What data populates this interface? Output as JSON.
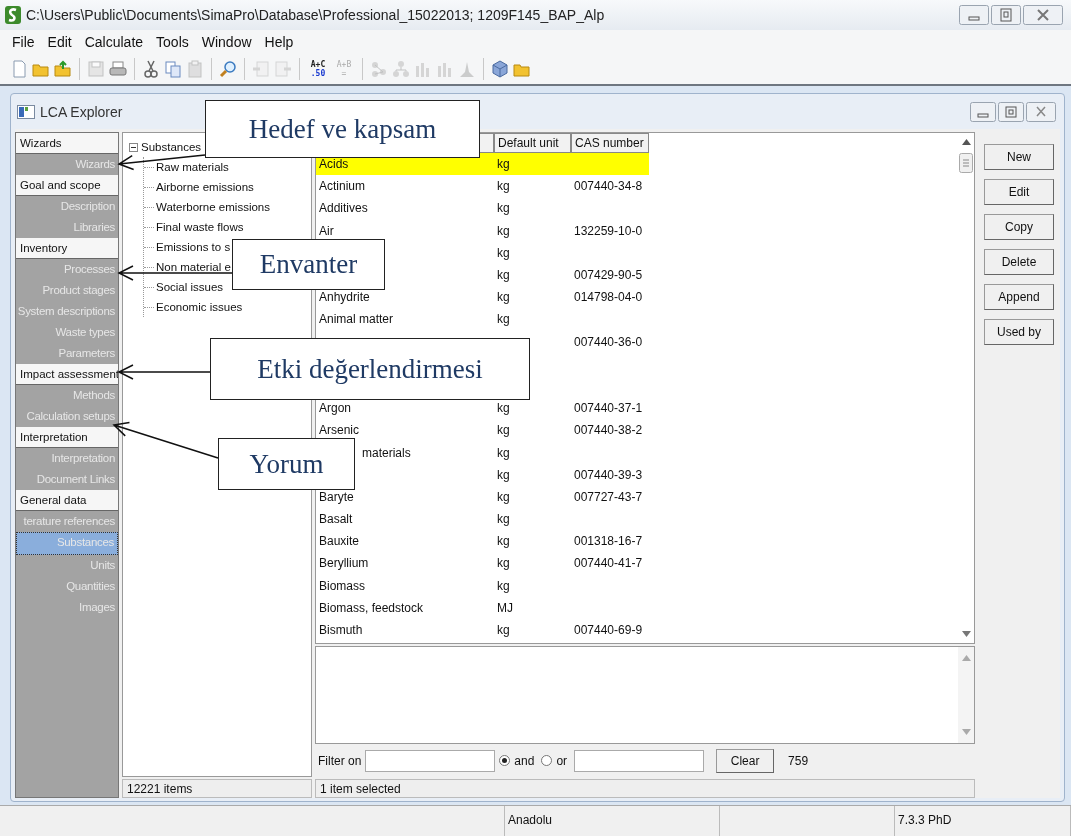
{
  "window": {
    "title": "C:\\Users\\Public\\Documents\\SimaPro\\Database\\Professional_15022013; 1209F145_BAP_Alp"
  },
  "menu": [
    "File",
    "Edit",
    "Calculate",
    "Tools",
    "Window",
    "Help"
  ],
  "toolbar": [
    {
      "kind": "new",
      "disabled": false
    },
    {
      "kind": "open",
      "disabled": false
    },
    {
      "kind": "open-up",
      "disabled": false
    },
    {
      "kind": "sep"
    },
    {
      "kind": "save",
      "disabled": true
    },
    {
      "kind": "print",
      "disabled": false
    },
    {
      "kind": "sep"
    },
    {
      "kind": "cut",
      "disabled": false
    },
    {
      "kind": "copy",
      "disabled": false
    },
    {
      "kind": "paste",
      "disabled": true
    },
    {
      "kind": "sep"
    },
    {
      "kind": "search",
      "disabled": false
    },
    {
      "kind": "sep"
    },
    {
      "kind": "doc-left",
      "disabled": true
    },
    {
      "kind": "doc-right",
      "disabled": true
    },
    {
      "kind": "sep"
    },
    {
      "kind": "formula",
      "top": "A+C",
      "bottom": ".50",
      "disabled": false
    },
    {
      "kind": "formula",
      "top": "A+B",
      "bottom": "=",
      "disabled": true
    },
    {
      "kind": "sep"
    },
    {
      "kind": "network",
      "disabled": true
    },
    {
      "kind": "tree",
      "disabled": true
    },
    {
      "kind": "bars",
      "disabled": true
    },
    {
      "kind": "bars",
      "disabled": true
    },
    {
      "kind": "peak",
      "disabled": true
    },
    {
      "kind": "sep"
    },
    {
      "kind": "box",
      "disabled": false
    },
    {
      "kind": "open",
      "disabled": false
    }
  ],
  "explorer": {
    "title": "LCA Explorer"
  },
  "sidebar": [
    {
      "label": "Wizards",
      "children": [
        {
          "label": "Wizards",
          "selected": false
        }
      ]
    },
    {
      "label": "Goal and scope",
      "children": [
        {
          "label": "Description",
          "selected": false
        },
        {
          "label": "Libraries",
          "selected": false
        }
      ]
    },
    {
      "label": "Inventory",
      "children": [
        {
          "label": "Processes",
          "selected": false
        },
        {
          "label": "Product stages",
          "selected": false
        },
        {
          "label": "System descriptions",
          "selected": false
        },
        {
          "label": "Waste types",
          "selected": false
        },
        {
          "label": "Parameters",
          "selected": false
        }
      ]
    },
    {
      "label": "Impact assessment",
      "children": [
        {
          "label": "Methods",
          "selected": false
        },
        {
          "label": "Calculation setups",
          "selected": false
        }
      ]
    },
    {
      "label": "Interpretation",
      "children": [
        {
          "label": "Interpretation",
          "selected": false
        },
        {
          "label": "Document Links",
          "selected": false
        }
      ]
    },
    {
      "label": "General data",
      "children": [
        {
          "label": "terature references",
          "selected": false
        },
        {
          "label": "Substances",
          "selected": true
        },
        {
          "label": "Units",
          "selected": false
        },
        {
          "label": "Quantities",
          "selected": false
        },
        {
          "label": "Images",
          "selected": false
        }
      ]
    }
  ],
  "tree": {
    "label": "Substances",
    "expanded": true,
    "children": [
      {
        "label": "Raw materials"
      },
      {
        "label": "Airborne emissions"
      },
      {
        "label": "Waterborne emissions"
      },
      {
        "label": "Final waste flows"
      },
      {
        "label": "Emissions to s"
      },
      {
        "label": "Non material e"
      },
      {
        "label": "Social issues"
      },
      {
        "label": "Economic issues"
      }
    ]
  },
  "tree_status": "12221 items",
  "table": {
    "columns": [
      "Default unit",
      "CAS number"
    ],
    "rows": [
      {
        "name": "Acids",
        "unit": "kg",
        "selected": true
      },
      {
        "name": "Actinium",
        "unit": "kg",
        "cas": "007440-34-8",
        "selected": false
      },
      {
        "name": "Additives",
        "unit": "kg",
        "selected": false
      },
      {
        "name": "Air",
        "unit": "kg",
        "cas": "132259-10-0",
        "selected": false
      },
      {
        "unit": "kg",
        "selected": false
      },
      {
        "unit": "kg",
        "cas": "007429-90-5",
        "selected": false
      },
      {
        "name": "Anhydrite",
        "unit": "kg",
        "cas": "014798-04-0",
        "selected": false
      },
      {
        "name": "Animal matter",
        "unit": "kg",
        "selected": false
      },
      {
        "cas": "007440-36-0",
        "selected": false
      },
      {
        "selected": false
      },
      {
        "selected": false
      },
      {
        "name": "Argon",
        "unit": "kg",
        "cas": "007440-37-1",
        "selected": false
      },
      {
        "name": "Arsenic",
        "unit": "kg",
        "cas": "007440-38-2",
        "selected": false
      },
      {
        "name_end": "materials",
        "unit": "kg",
        "selected": false
      },
      {
        "unit": "kg",
        "cas": "007440-39-3",
        "selected": false
      },
      {
        "name": "Baryte",
        "unit": "kg",
        "cas": "007727-43-7",
        "selected": false
      },
      {
        "name": "Basalt",
        "unit": "kg",
        "selected": false
      },
      {
        "name": "Bauxite",
        "unit": "kg",
        "cas": "001318-16-7",
        "selected": false
      },
      {
        "name": "Beryllium",
        "unit": "kg",
        "cas": "007440-41-7",
        "selected": false
      },
      {
        "name": "Biomass",
        "unit": "kg",
        "selected": false
      },
      {
        "name": "Biomass, feedstock",
        "unit": "MJ",
        "selected": false
      },
      {
        "name": "Bismuth",
        "unit": "kg",
        "cas": "007440-69-9",
        "selected": false
      }
    ]
  },
  "filter": {
    "label": "Filter on",
    "modes": [
      {
        "label": "and",
        "selected": true
      },
      {
        "label": "or",
        "selected": false
      }
    ],
    "clear": "Clear",
    "count": "759"
  },
  "list_status": "1 item selected",
  "buttons": [
    "New",
    "Edit",
    "Copy",
    "Delete",
    "Append",
    "Used by"
  ],
  "status_bar": [
    "Anadolu",
    "7.3.3 PhD"
  ],
  "annotations": [
    {
      "text": "Hedef ve kapsam"
    },
    {
      "text": "Envanter"
    },
    {
      "text": "Etki değerlendirmesi"
    },
    {
      "text": "Yorum"
    }
  ]
}
